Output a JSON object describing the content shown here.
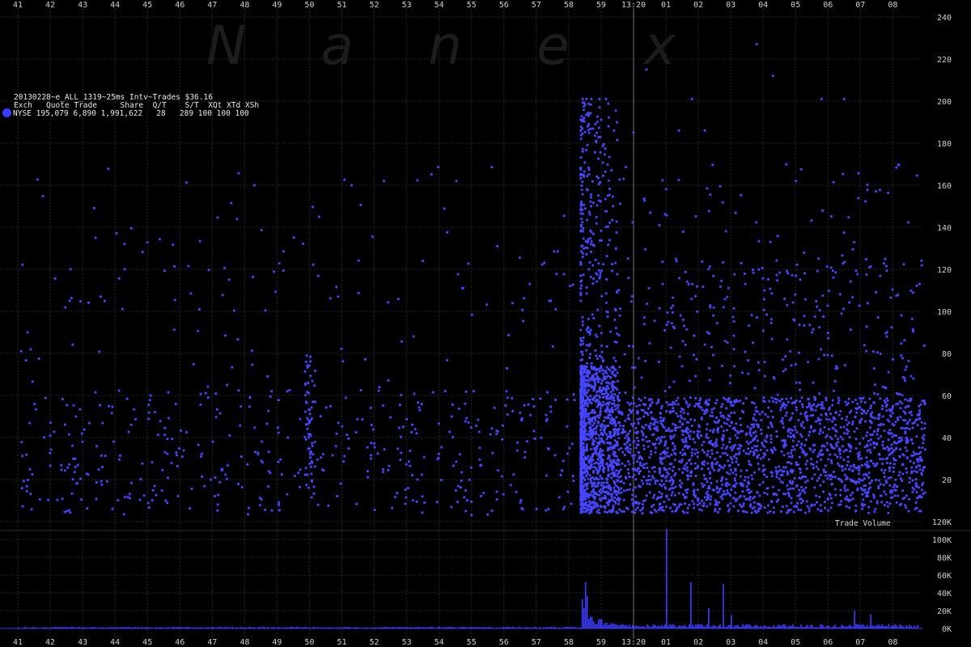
{
  "watermark": "Nanex",
  "header": {
    "title": "20130228~e_ALL_1319~25ms Intv~Trades $36.16",
    "columns": "Exch   Quote Trade     Share  Q/T    S/T  XQt XTd XSh",
    "row": "NYSE 195,079 6,890 1,991,622   28   289 100 100 100",
    "legend_color": "#3b3bff"
  },
  "chart_data": [
    {
      "type": "scatter",
      "title": "",
      "series": [
        {
          "name": "NYSE",
          "color": "#4646ff"
        }
      ],
      "x_ticks": [
        "41",
        "42",
        "43",
        "44",
        "45",
        "46",
        "47",
        "48",
        "49",
        "50",
        "51",
        "52",
        "53",
        "54",
        "55",
        "56",
        "57",
        "58",
        "59",
        "13:20",
        "01",
        "02",
        "03",
        "04",
        "05",
        "06",
        "07",
        "08"
      ],
      "ylim": [
        0,
        240
      ],
      "y_ticks": [
        20,
        40,
        60,
        80,
        100,
        120,
        140,
        160,
        180,
        200,
        220,
        240
      ],
      "grid": true,
      "marker_time": "13:20",
      "x": [],
      "y": []
    },
    {
      "type": "bar",
      "title": "Trade Volume",
      "series": [
        {
          "name": "NYSE",
          "color": "#3c3cff"
        }
      ],
      "ylim": [
        0,
        120000
      ],
      "y_tick_labels": [
        "0K",
        "20K",
        "40K",
        "60K",
        "80K",
        "100K",
        "120K"
      ],
      "y_tick_values": [
        0,
        20000,
        40000,
        60000,
        80000,
        100000,
        120000
      ],
      "x_ticks": [
        "41",
        "42",
        "43",
        "44",
        "45",
        "46",
        "47",
        "48",
        "49",
        "50",
        "51",
        "52",
        "53",
        "54",
        "55",
        "56",
        "57",
        "58",
        "59",
        "13:20",
        "01",
        "02",
        "03",
        "04",
        "05",
        "06",
        "07",
        "08"
      ],
      "values": []
    }
  ]
}
